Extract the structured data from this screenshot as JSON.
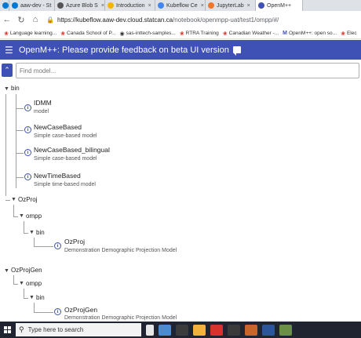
{
  "browser": {
    "tabs": [
      {
        "label": "aaw-dev - St",
        "color": "#0078d4",
        "active": false
      },
      {
        "label": "Azure Blob S",
        "color": "#555555",
        "active": false
      },
      {
        "label": "Introduction",
        "color": "#f4b400",
        "active": false
      },
      {
        "label": "Kubeflow Ce",
        "color": "#4285f4",
        "active": false
      },
      {
        "label": "JupyterLab",
        "color": "#f37726",
        "active": false
      },
      {
        "label": "OpenM++",
        "color": "#3f51b5",
        "active": true
      }
    ],
    "url_host": "https://kubeflow.aaw-dev.cloud.statcan.ca",
    "url_path": "/notebook/openmpp-uat/test1/ompp/#/",
    "bookmarks": [
      {
        "label": "Language learning...",
        "icon": "maple-leaf-icon"
      },
      {
        "label": "Canada School of P...",
        "icon": "maple-leaf-icon"
      },
      {
        "label": "sas-inttech-samples...",
        "icon": "github-icon"
      },
      {
        "label": "RTRA Training",
        "icon": "maple-leaf-icon"
      },
      {
        "label": "Canadian Weather -...",
        "icon": "maple-leaf-icon"
      },
      {
        "label": "OpenM++: open so...",
        "icon": "openm-icon"
      },
      {
        "label": "Elec",
        "icon": "maple-leaf-icon"
      }
    ]
  },
  "app": {
    "title": "OpenM++: Please provide feedback on beta UI version",
    "accent": "#3f51b5",
    "search_placeholder": "Find model..."
  },
  "tree": {
    "root": "bin",
    "models": [
      {
        "name": "IDMM",
        "desc": "model"
      },
      {
        "name": "NewCaseBased",
        "desc": "Simple case-based model"
      },
      {
        "name": "NewCaseBased_bilingual",
        "desc": "Simple case-based model"
      },
      {
        "name": "NewTimeBased",
        "desc": "Simple time-based model"
      }
    ],
    "folders": [
      {
        "name": "OzProj",
        "sub": "ompp",
        "subsub": "bin",
        "model": {
          "name": "OzProj",
          "desc": "Demonstration Demographic Projection Model"
        }
      },
      {
        "name": "OzProjGen",
        "sub": "ompp",
        "subsub": "bin",
        "model": {
          "name": "OzProjGen",
          "desc": "Demonstration Demographic Projection Model"
        }
      }
    ]
  },
  "taskbar": {
    "search_text": "Type here to search"
  }
}
